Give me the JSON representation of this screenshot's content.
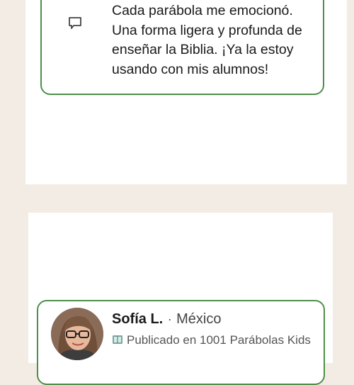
{
  "testimonial_top": {
    "quote_lines": [
      "Cada parábola me emocionó.",
      "Una forma ligera y profunda de",
      "enseñar la Biblia. ¡Ya la estoy",
      "usando con mis alumnos!"
    ]
  },
  "testimonial_bottom": {
    "name": "Sofía L.",
    "separator": "·",
    "country": "México",
    "published": "Publicado en 1001 Parábolas Kids"
  },
  "colors": {
    "page_background": "#f3ece4",
    "card_border": "#4e8f4a",
    "text": "#1a1a1a"
  },
  "icons": [
    "comment-icon",
    "book-icon"
  ]
}
